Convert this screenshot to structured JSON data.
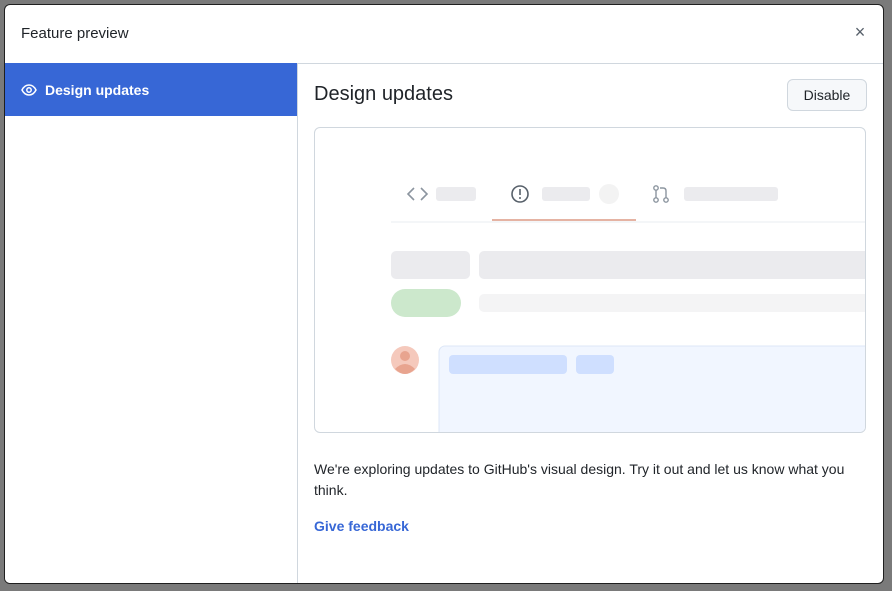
{
  "dialog": {
    "title": "Feature preview",
    "close_symbol": "×"
  },
  "sidebar": {
    "items": [
      {
        "label": "Design updates",
        "icon": "eye-icon",
        "selected": true
      }
    ]
  },
  "main": {
    "title": "Design updates",
    "disable_label": "Disable",
    "description": "We're exploring updates to GitHub's visual design. Try it out and let us know what you think.",
    "feedback_label": "Give feedback"
  },
  "colors": {
    "accent": "#3767d6",
    "tab_underline": "#e5b3a3",
    "label_green": "#cce8cc",
    "skeleton": "#ebebee",
    "comment_bg": "#f1f6ff"
  }
}
